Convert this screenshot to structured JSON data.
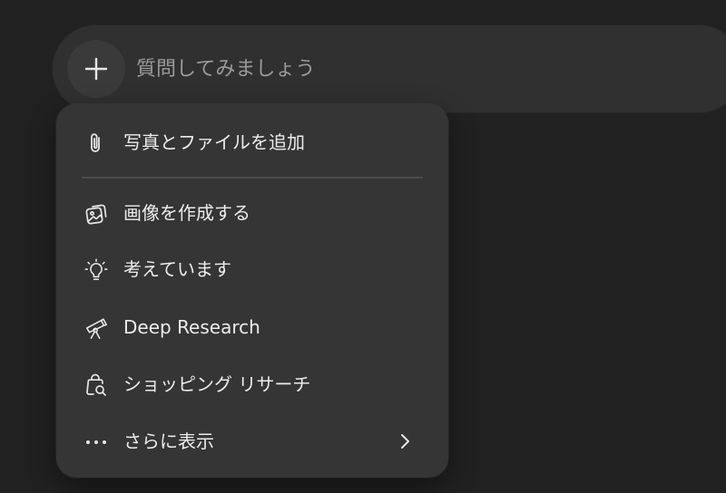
{
  "composer": {
    "placeholder": "質問してみましょう",
    "plus_icon": "plus-icon"
  },
  "menu": {
    "items": [
      {
        "label": "写真とファイルを追加",
        "icon": "paperclip-icon"
      },
      {
        "label": "画像を作成する",
        "icon": "image-icon"
      },
      {
        "label": "考えています",
        "icon": "lightbulb-icon"
      },
      {
        "label": "Deep Research",
        "icon": "telescope-icon"
      },
      {
        "label": "ショッピング リサーチ",
        "icon": "shopping-bag-search-icon"
      },
      {
        "label": "さらに表示",
        "icon": "more-horizontal-icon",
        "chevron": "chevron-right-icon"
      }
    ]
  },
  "colors": {
    "background": "#212121",
    "composer": "#303030",
    "menu": "#353535",
    "text": "#ececec",
    "placeholder": "#9b9b9b"
  }
}
